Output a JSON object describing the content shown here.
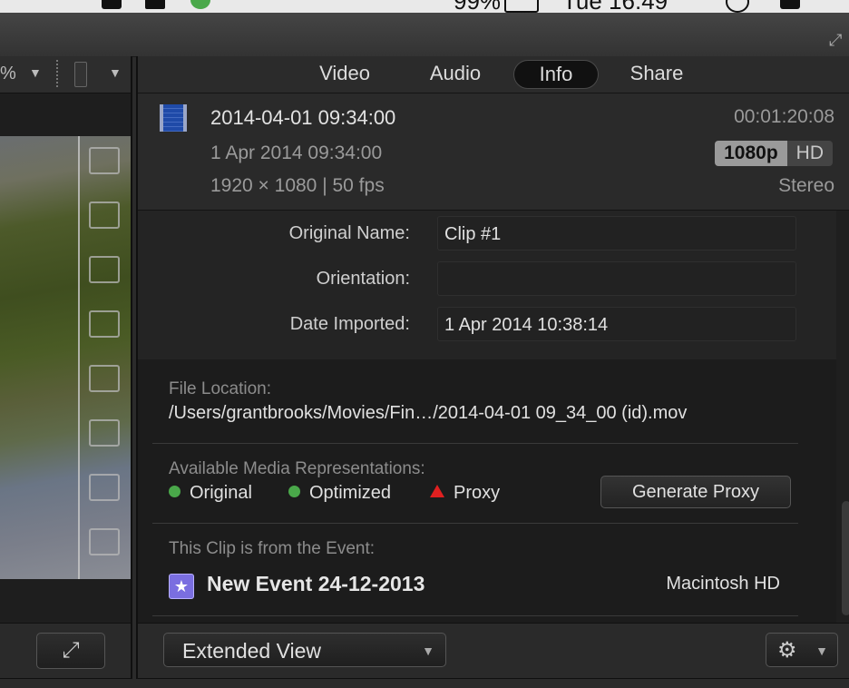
{
  "menubar": {
    "status_text": "Tue 16:49",
    "battery": "99%"
  },
  "viewer": {
    "zoom_text": "%",
    "thumbnails": 8
  },
  "inspector": {
    "tabs": [
      {
        "label": "Video",
        "active": false
      },
      {
        "label": "Audio",
        "active": false
      },
      {
        "label": "Info",
        "active": true
      },
      {
        "label": "Share",
        "active": false
      }
    ],
    "header": {
      "title": "2014-04-01 09:34:00",
      "date": "1 Apr 2014 09:34:00",
      "format": "1920 × 1080 | 50 fps",
      "duration": "00:01:20:08",
      "resolution_badge": "1080p",
      "hd_badge": "HD",
      "audio": "Stereo"
    },
    "metadata": {
      "original_name_label": "Original Name:",
      "original_name_value": "Clip #1",
      "orientation_label": "Orientation:",
      "orientation_value": "",
      "date_imported_label": "Date Imported:",
      "date_imported_value": "1 Apr 2014 10:38:14"
    },
    "file_location": {
      "label": "File Location:",
      "path": "/Users/grantbrooks/Movies/Fin…/2014-04-01 09_34_00 (id).mov"
    },
    "media": {
      "label": "Available Media Representations:",
      "original": "Original",
      "optimized": "Optimized",
      "proxy": "Proxy",
      "generate_button": "Generate Proxy"
    },
    "event": {
      "label": "This Clip is from the Event:",
      "name": "New Event 24-12-2013",
      "volume": "Macintosh HD"
    },
    "footer": {
      "view_select": "Extended View"
    }
  },
  "colors": {
    "status_green": "#4aa84a",
    "status_red": "#e02020",
    "event_purple": "#7a6ee0",
    "clip_blue": "#1f4aa8"
  },
  "icons": [
    "clip-film-icon",
    "event-star-icon",
    "gear-icon",
    "expand-icon",
    "fullscreen-icon",
    "chevron-down-icon"
  ]
}
